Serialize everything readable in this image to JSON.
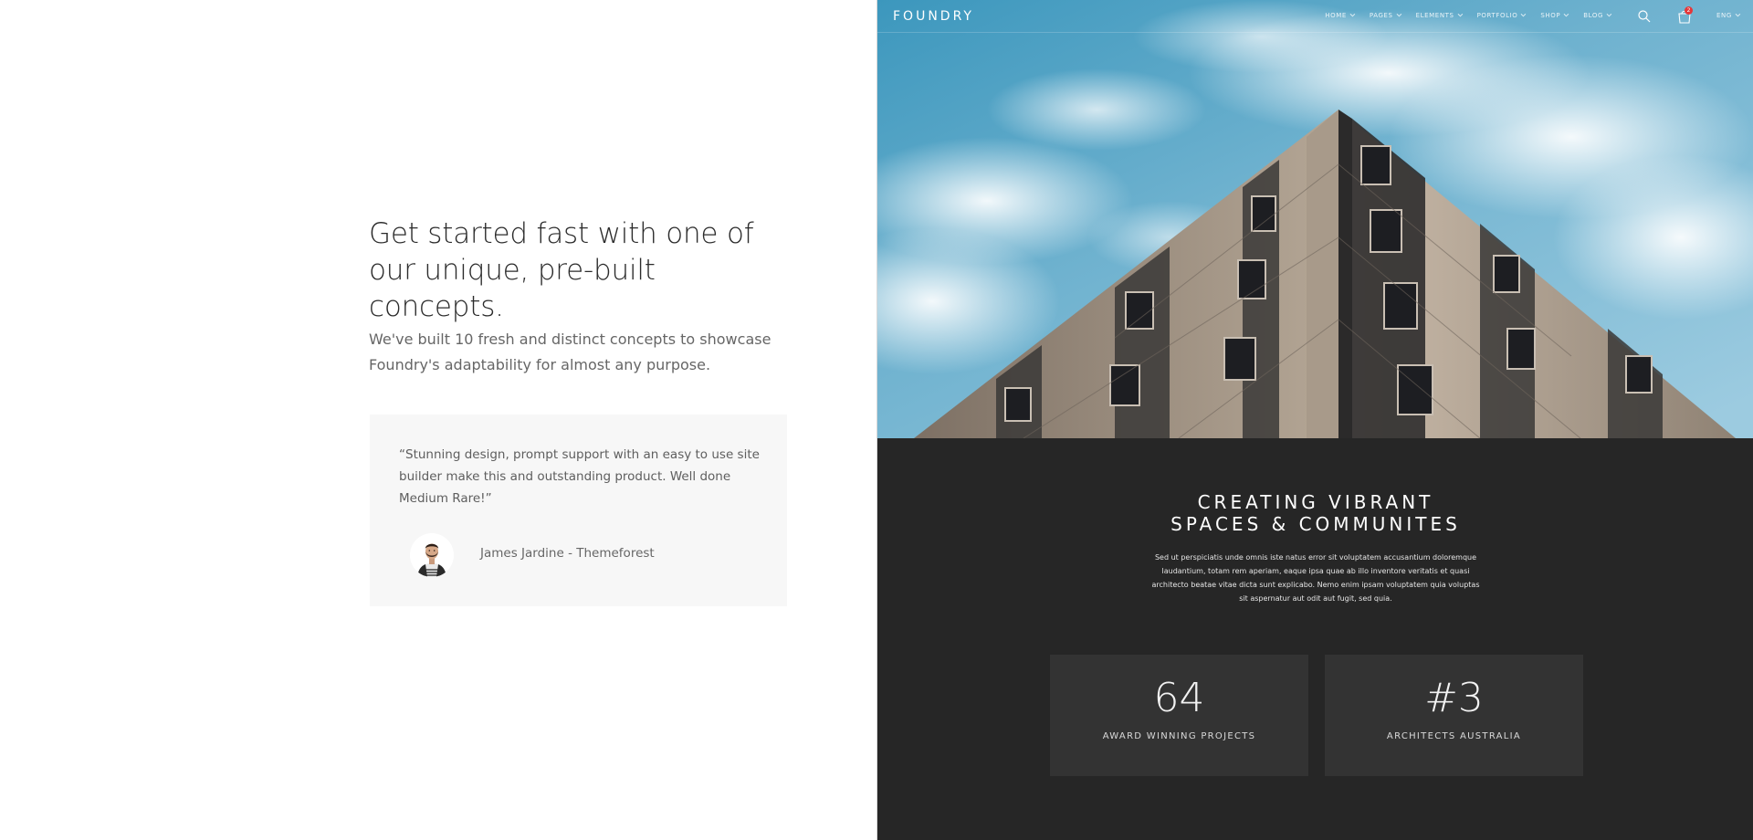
{
  "left": {
    "headline": "Get started fast with one of our unique, pre-built concepts.",
    "lede": "We've built 10 fresh and distinct concepts to showcase Foundry's adaptability for almost any purpose.",
    "testimonial": {
      "quote": "“Stunning design, prompt support with an easy to use site builder make this and outstanding product. Well done Medium Rare!”",
      "author": "James Jardine - Themeforest"
    }
  },
  "preview": {
    "navbar": {
      "logo": "FOUNDRY",
      "items": [
        {
          "label": "HOME"
        },
        {
          "label": "PAGES"
        },
        {
          "label": "ELEMENTS"
        },
        {
          "label": "PORTFOLIO"
        },
        {
          "label": "SHOP"
        },
        {
          "label": "BLOG"
        }
      ],
      "cart_count": "2",
      "language": "ENG"
    },
    "section": {
      "title_line1": "CREATING VIBRANT",
      "title_line2": "SPACES & COMMUNITES",
      "body": "Sed ut perspiciatis unde omnis iste natus error sit voluptatem accusantium doloremque laudantium, totam rem aperiam, eaque ipsa quae ab illo inventore veritatis et quasi architecto beatae vitae dicta sunt explicabo. Nemo enim ipsam voluptatem quia voluptas sit aspernatur aut odit aut fugit, sed quia."
    },
    "stats": [
      {
        "number": "64",
        "label": "AWARD WINNING PROJECTS"
      },
      {
        "number": "#3",
        "label": "ARCHITECTS AUSTRALIA"
      }
    ]
  },
  "colors": {
    "dark_section": "#262626",
    "stat_card": "#333333",
    "sky": "#4a9cc0",
    "badge": "#e4373a"
  }
}
